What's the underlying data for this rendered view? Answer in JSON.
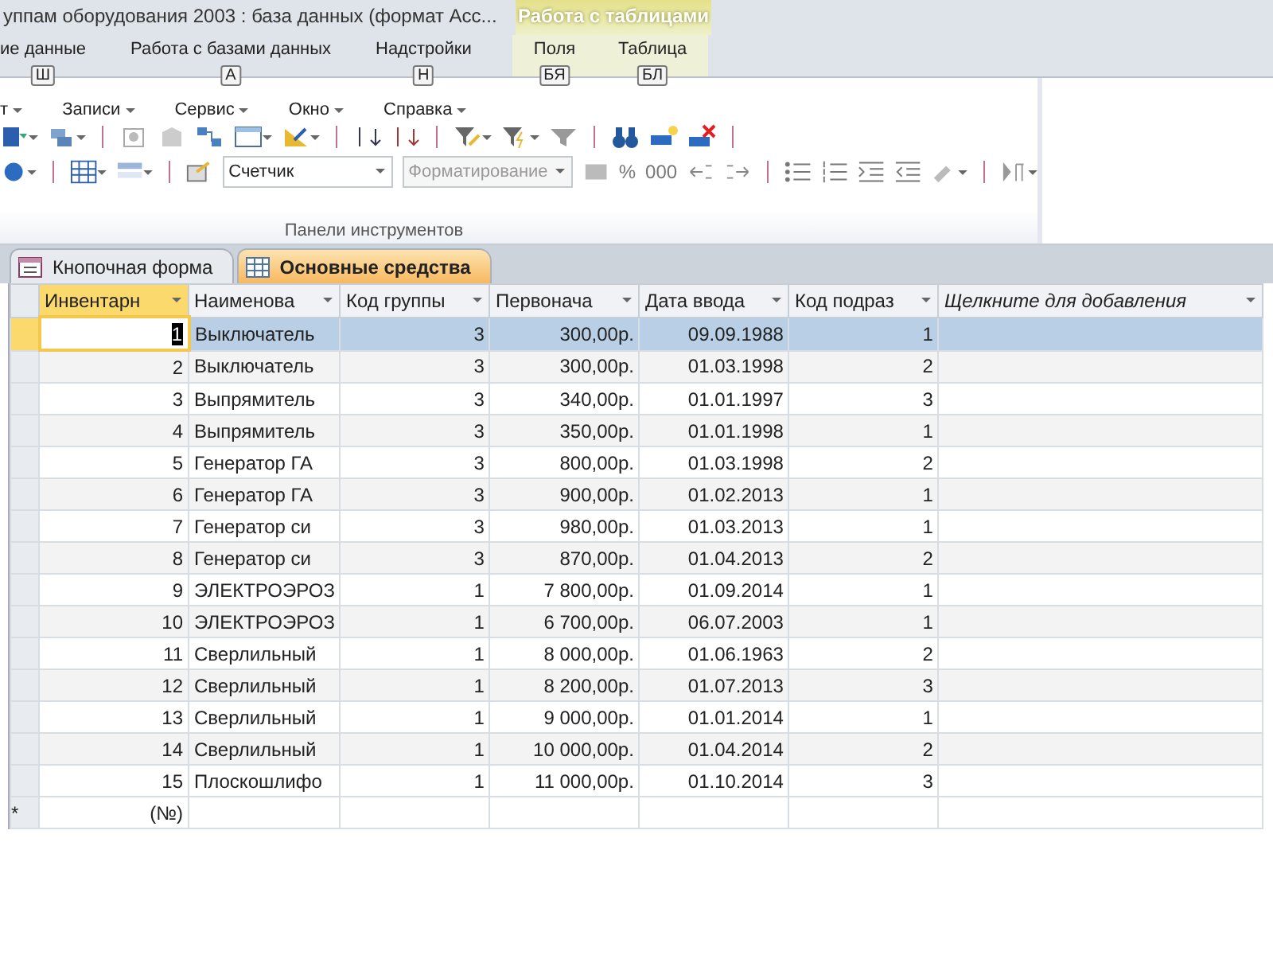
{
  "window": {
    "title": "уппам оборудования 2003 : база данных (формат Acc..."
  },
  "contextual_tab_group": {
    "label": "Работа с таблицами"
  },
  "ribbon_tabs": [
    {
      "label": "ие данные",
      "keytip": "Ш",
      "contextual": false
    },
    {
      "label": "Работа с базами данных",
      "keytip": "А",
      "contextual": false
    },
    {
      "label": "Надстройки",
      "keytip": "Н",
      "contextual": false
    },
    {
      "label": "Поля",
      "keytip": "БЯ",
      "contextual": true
    },
    {
      "label": "Таблица",
      "keytip": "БЛ",
      "contextual": true
    }
  ],
  "menu": [
    {
      "label": "т"
    },
    {
      "label": "Записи"
    },
    {
      "label": "Сервис"
    },
    {
      "label": "Окно"
    },
    {
      "label": "Справка"
    }
  ],
  "toolbar": {
    "field_type": {
      "value": "Счетчик"
    },
    "format": {
      "value": "Форматирование",
      "disabled": true
    },
    "percent": "%",
    "thousands": "000",
    "group_label": "Панели инструментов"
  },
  "document_tabs": [
    {
      "label": "Кнопочная форма",
      "kind": "form",
      "selected": false
    },
    {
      "label": "Основные средства",
      "kind": "table",
      "selected": true
    }
  ],
  "table": {
    "columns": [
      {
        "label": "Инвентарн"
      },
      {
        "label": "Наименова"
      },
      {
        "label": "Код группы"
      },
      {
        "label": "Первонача"
      },
      {
        "label": "Дата ввода"
      },
      {
        "label": "Код подраз"
      },
      {
        "label": "Щелкните для добавления"
      }
    ],
    "rows": [
      {
        "cells": [
          "1",
          "Выключатель",
          "3",
          "300,00р.",
          "09.09.1988",
          "1"
        ],
        "selected": true
      },
      {
        "cells": [
          "2",
          "Выключатель",
          "3",
          "300,00р.",
          "01.03.1998",
          "2"
        ],
        "selected": false
      },
      {
        "cells": [
          "3",
          "Выпрямитель",
          "3",
          "340,00р.",
          "01.01.1997",
          "3"
        ],
        "selected": false
      },
      {
        "cells": [
          "4",
          "Выпрямитель",
          "3",
          "350,00р.",
          "01.01.1998",
          "1"
        ],
        "selected": false
      },
      {
        "cells": [
          "5",
          "Генератор ГА",
          "3",
          "800,00р.",
          "01.03.1998",
          "2"
        ],
        "selected": false
      },
      {
        "cells": [
          "6",
          "Генератор ГА",
          "3",
          "900,00р.",
          "01.02.2013",
          "1"
        ],
        "selected": false
      },
      {
        "cells": [
          "7",
          "Генератор си",
          "3",
          "980,00р.",
          "01.03.2013",
          "1"
        ],
        "selected": false
      },
      {
        "cells": [
          "8",
          "Генератор си",
          "3",
          "870,00р.",
          "01.04.2013",
          "2"
        ],
        "selected": false
      },
      {
        "cells": [
          "9",
          "ЭЛЕКТРОЭРОЗ",
          "1",
          "7 800,00р.",
          "01.09.2014",
          "1"
        ],
        "selected": false
      },
      {
        "cells": [
          "10",
          "ЭЛЕКТРОЭРОЗ",
          "1",
          "6 700,00р.",
          "06.07.2003",
          "1"
        ],
        "selected": false
      },
      {
        "cells": [
          "11",
          "Сверлильный",
          "1",
          "8 000,00р.",
          "01.06.1963",
          "2"
        ],
        "selected": false
      },
      {
        "cells": [
          "12",
          "Сверлильный",
          "1",
          "8 200,00р.",
          "01.07.2013",
          "3"
        ],
        "selected": false
      },
      {
        "cells": [
          "13",
          "Сверлильный",
          "1",
          "9 000,00р.",
          "01.01.2014",
          "1"
        ],
        "selected": false
      },
      {
        "cells": [
          "14",
          "Сверлильный",
          "1",
          "10 000,00р.",
          "01.04.2014",
          "2"
        ],
        "selected": false
      },
      {
        "cells": [
          "15",
          "Плоскошлифо",
          "1",
          "11 000,00р.",
          "01.10.2014",
          "3"
        ],
        "selected": false
      }
    ],
    "new_row": {
      "marker": "*",
      "placeholder": "(№)"
    }
  }
}
